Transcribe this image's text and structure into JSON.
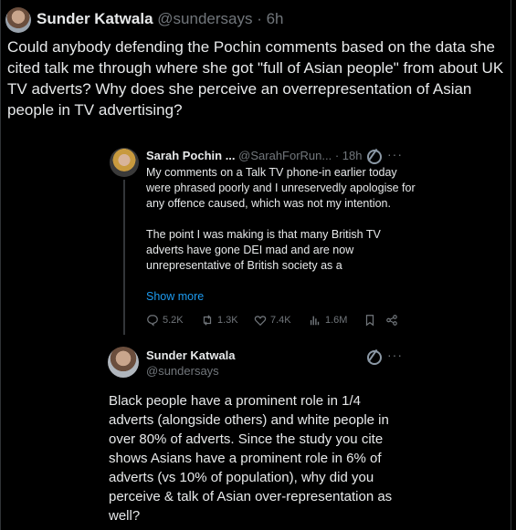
{
  "tweet": {
    "author_name": "Sunder Katwala",
    "author_handle": "@sundersays",
    "time": "6h",
    "text": "Could anybody defending the Pochin comments based on the data she cited talk me through where she got \"full of Asian people\" from about UK TV adverts? Why does she perceive an overrepresentation of Asian people in TV advertising?"
  },
  "quoted": {
    "author_name": "Sarah Pochin ...",
    "author_handle": "@SarahForRun...",
    "time": "18h",
    "paragraph1": "My comments on a Talk TV phone-in earlier today were phrased poorly and I unreservedly apologise for any offence caused, which was not my intention.",
    "paragraph2": "The point I was making is that many British TV adverts have gone DEI mad and are now unrepresentative of British society as a",
    "show_more": "Show more",
    "replies": "5.2K",
    "reposts": "1.3K",
    "likes": "7.4K",
    "views": "1.6M"
  },
  "reply": {
    "author_name": "Sunder Katwala",
    "author_handle": "@sundersays",
    "text": "Black people have a prominent role in 1/4 adverts (alongside others) and white people in over 80% of adverts. Since the study you cite shows Asians have a prominent role in 6% of adverts (vs 10% of population), why did you perceive & talk of Asian over-representation as well?"
  },
  "icons": {
    "more": "more-icon",
    "grok": "grok-icon",
    "reply": "reply-icon",
    "repost": "repost-icon",
    "like": "like-icon",
    "views": "views-icon",
    "bookmark": "bookmark-icon",
    "share": "share-icon"
  },
  "colors": {
    "background": "#000000",
    "text": "#e7e9ea",
    "muted": "#71767b",
    "link": "#1d9bf0"
  }
}
